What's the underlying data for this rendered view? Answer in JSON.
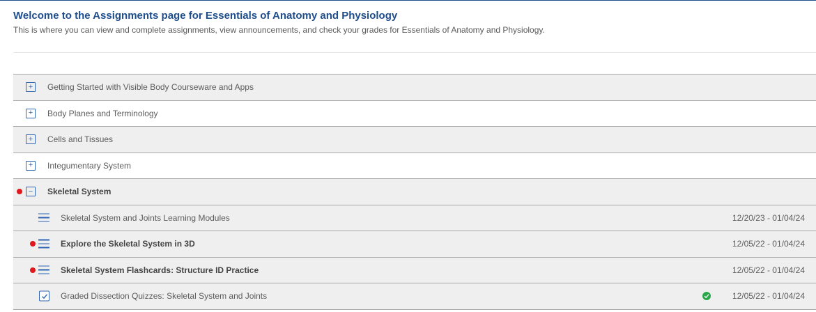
{
  "header": {
    "title": "Welcome to the Assignments page for Essentials of Anatomy and Physiology",
    "subtitle": "This is where you can view and complete assignments, view announcements, and check your grades for Essentials of Anatomy and Physiology."
  },
  "sections": [
    {
      "label": "Getting Started with Visible Body Courseware and Apps",
      "toggle": "+",
      "expanded": false,
      "unread": false
    },
    {
      "label": "Body Planes and Terminology",
      "toggle": "+",
      "expanded": false,
      "unread": false
    },
    {
      "label": "Cells and Tissues",
      "toggle": "+",
      "expanded": false,
      "unread": false
    },
    {
      "label": "Integumentary System",
      "toggle": "+",
      "expanded": false,
      "unread": false
    },
    {
      "label": "Skeletal System",
      "toggle": "−",
      "expanded": true,
      "unread": true
    }
  ],
  "assignments": [
    {
      "label": "Skeletal System and Joints Learning Modules",
      "dates": "12/20/23 - 01/04/24",
      "icon": "list-icon",
      "unread": false,
      "completed": false
    },
    {
      "label": "Explore the Skeletal System in 3D",
      "dates": "12/05/22 - 01/04/24",
      "icon": "list-icon",
      "unread": true,
      "completed": false
    },
    {
      "label": "Skeletal System Flashcards: Structure ID Practice",
      "dates": "12/05/22 - 01/04/24",
      "icon": "list-icon",
      "unread": true,
      "completed": false
    },
    {
      "label": "Graded Dissection Quizzes: Skeletal System and Joints",
      "dates": "12/05/22 - 01/04/24",
      "icon": "checkbox-icon",
      "unread": false,
      "completed": true
    }
  ],
  "colors": {
    "title": "#1e4d8c",
    "accent": "#2f65b0",
    "unread_dot": "#e0191e",
    "completed": "#2aa84a"
  }
}
